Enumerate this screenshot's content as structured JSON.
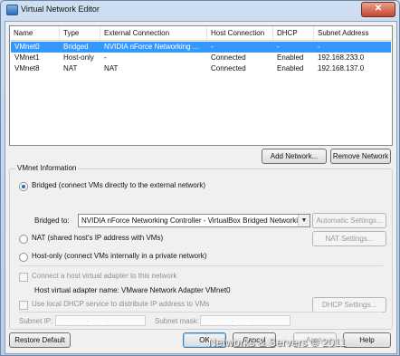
{
  "window": {
    "title": "Virtual Network Editor",
    "close_label": "✕"
  },
  "table": {
    "columns": [
      "Name",
      "Type",
      "External Connection",
      "Host Connection",
      "DHCP",
      "Subnet Address"
    ],
    "rows": [
      {
        "name": "VMnet0",
        "type": "Bridged",
        "external": "NVIDIA nForce Networking ...",
        "host": "-",
        "dhcp": "-",
        "subnet": "-",
        "selected": true
      },
      {
        "name": "VMnet1",
        "type": "Host-only",
        "external": "-",
        "host": "Connected",
        "dhcp": "Enabled",
        "subnet": "192.168.233.0",
        "selected": false
      },
      {
        "name": "VMnet8",
        "type": "NAT",
        "external": "NAT",
        "host": "Connected",
        "dhcp": "Enabled",
        "subnet": "192.168.137.0",
        "selected": false
      }
    ]
  },
  "actions": {
    "add_network": "Add Network...",
    "remove_network": "Remove Network"
  },
  "vmnet_info": {
    "title": "VMnet Information",
    "bridged_label": "Bridged (connect VMs directly to the external network)",
    "bridged_to_label": "Bridged to:",
    "bridged_to_value": "NVIDIA nForce Networking Controller - VirtualBox Bridged Networkir",
    "automatic_settings": "Automatic Settings...",
    "nat_label": "NAT (shared host's IP address with VMs)",
    "nat_settings": "NAT Settings...",
    "hostonly_label": "Host-only (connect VMs internally in a private network)",
    "connect_adapter_label": "Connect a host virtual adapter to this network",
    "adapter_name_label": "Host virtual adapter name: VMware Network Adapter VMnet0",
    "dhcp_label": "Use local DHCP service to distribute IP address to VMs",
    "dhcp_settings": "DHCP Settings...",
    "subnet_ip_label": "Subnet IP:",
    "subnet_mask_label": "Subnet mask:",
    "ip_placeholder": ". . .",
    "selected_mode": "bridged"
  },
  "footer": {
    "restore_default": "Restore Default",
    "ok": "OK",
    "cancel": "Cancel",
    "apply": "Apply",
    "help": "Help"
  },
  "watermark": "Networks & Servers © 2011",
  "colors": {
    "selection": "#3399ff",
    "title_gradient": "#b9cde7",
    "close_button": "#c7452c"
  }
}
